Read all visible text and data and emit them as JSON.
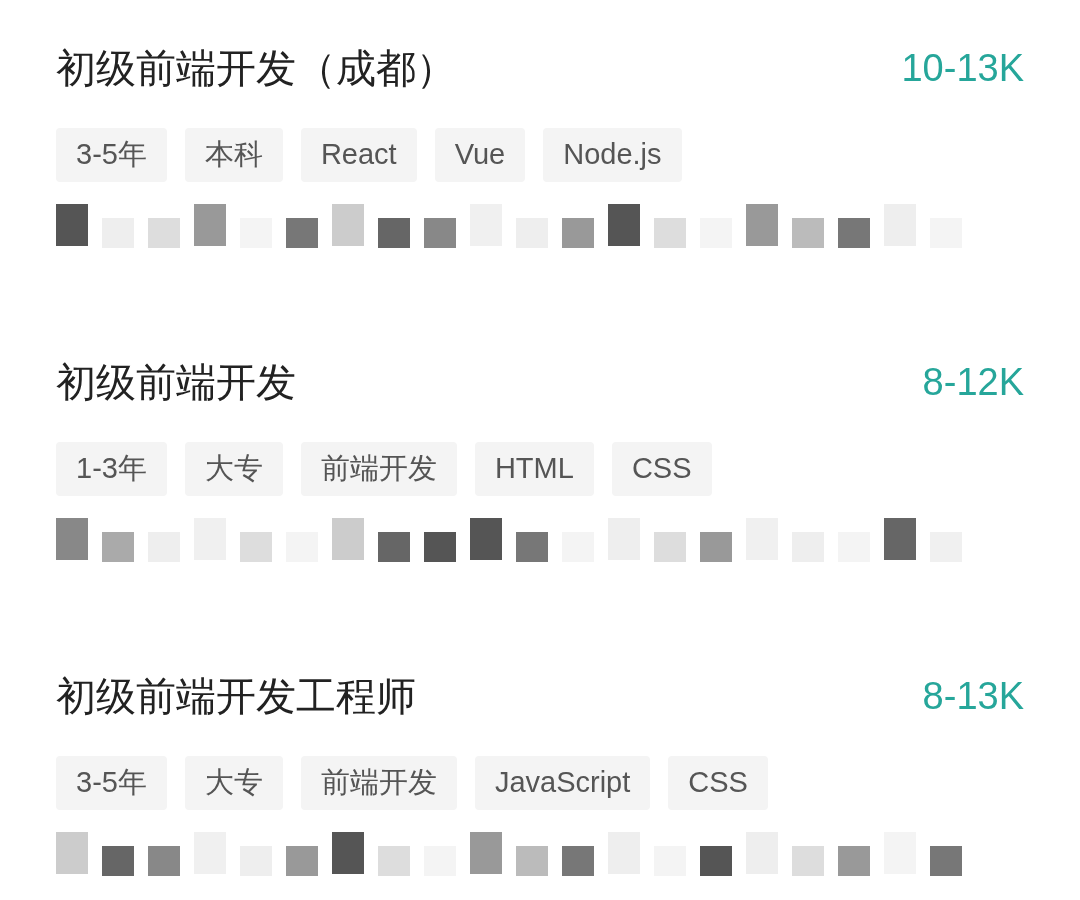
{
  "jobs": [
    {
      "title": "初级前端开发（成都）",
      "salary": "10-13K",
      "tags": [
        "3-5年",
        "本科",
        "React",
        "Vue",
        "Node.js"
      ],
      "description": {
        "kind": "redacted"
      }
    },
    {
      "title": "初级前端开发",
      "salary": "8-12K",
      "tags": [
        "1-3年",
        "大专",
        "前端开发",
        "HTML",
        "CSS"
      ],
      "description": {
        "kind": "redacted"
      }
    },
    {
      "title": "初级前端开发工程师",
      "salary": "8-13K",
      "tags": [
        "3-5年",
        "大专",
        "前端开发",
        "JavaScript",
        "CSS"
      ],
      "description": {
        "kind": "redacted"
      }
    }
  ]
}
